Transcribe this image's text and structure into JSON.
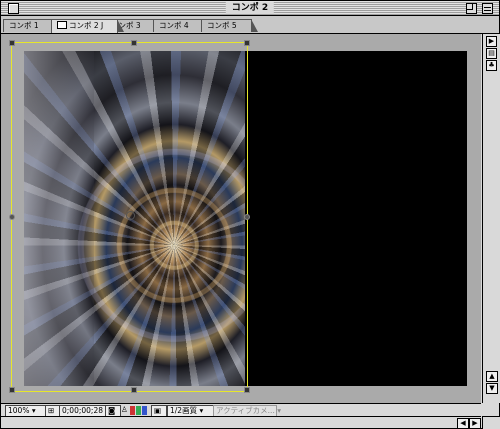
{
  "window": {
    "title": "コンポ 2"
  },
  "tabs": [
    {
      "label": "コンポ 1",
      "active": false
    },
    {
      "label": "コンポ 2 J",
      "active": true,
      "icon": "composition-icon"
    },
    {
      "label": "コンポ 3",
      "active": false
    },
    {
      "label": "コンポ 4",
      "active": false
    },
    {
      "label": "コンポ 5",
      "active": false
    }
  ],
  "statusbar": {
    "zoom": "100%",
    "timecode": "0;00;00;28",
    "resolution": "1/2画質",
    "camera": "アクティブカメ..."
  },
  "colors": {
    "background": "#d9d9d9",
    "canvas": "#000000",
    "layer_bounds": "#e6e62a",
    "channel_red": "#cc3333",
    "channel_green": "#33aa55",
    "channel_blue": "#3355cc"
  },
  "icons": {
    "close": "close-box-icon",
    "zoom": "zoom-box-icon",
    "collapse": "collapse-box-icon",
    "fit": "fit-frame-icon",
    "snapshot": "camera-snapshot-icon",
    "alpha": "channels-icon",
    "region": "region-of-interest-icon"
  }
}
